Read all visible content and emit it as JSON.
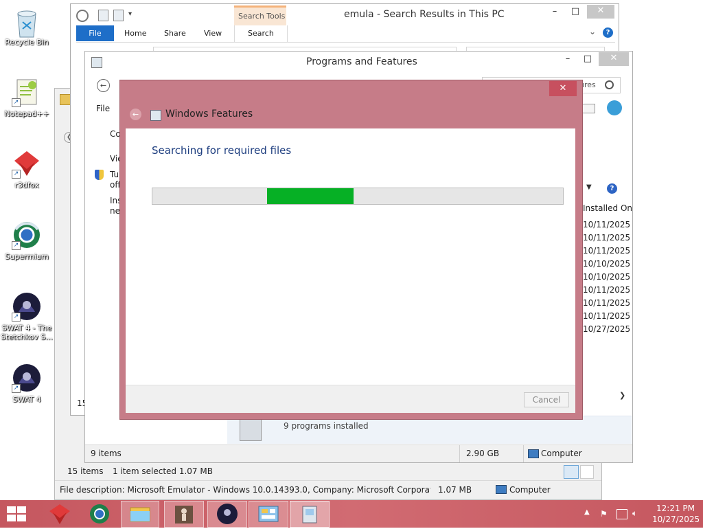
{
  "desktop_icons": [
    {
      "label": "Recycle Bin",
      "icon": "recycle-bin-icon"
    },
    {
      "label": "Notepad++",
      "icon": "notepad-plus-plus-icon"
    },
    {
      "label": "r3dfox",
      "icon": "r3dfox-icon"
    },
    {
      "label": "Supermium",
      "icon": "supermium-icon"
    },
    {
      "label": "SWAT 4 - The Stetchkov S...",
      "icon": "swat4-expansion-icon"
    },
    {
      "label": "SWAT 4",
      "icon": "swat4-icon"
    }
  ],
  "explorer": {
    "title": "emula - Search Results in This PC",
    "contextual_tab": "Search Tools",
    "ribbon_tabs": [
      "File",
      "Home",
      "Share",
      "View",
      "Search"
    ],
    "status_items": "15 items",
    "status_selected": "1 item selected  1.07 MB",
    "details_bar": "File description: Microsoft Emulator - Windows 10.0.14393.0, Company: Microsoft Corporation, File vers",
    "details_size": "1.07 MB",
    "details_location": "Computer",
    "side_partial": "15"
  },
  "programs": {
    "title": "Programs and Features",
    "menu_file": "File",
    "search_partial": "ures",
    "left_links": [
      "Co",
      "Vie",
      "Tur",
      "off",
      "Inst",
      "net"
    ],
    "column_installed_on": "Installed On",
    "installed_dates": [
      "10/11/2025",
      "10/11/2025",
      "10/11/2025",
      "10/10/2025",
      "10/10/2025",
      "10/11/2025",
      "10/11/2025",
      "10/11/2025",
      "10/27/2025"
    ],
    "programs_installed": "9 programs installed",
    "status_items": "9 items",
    "status_size": "2.90 GB",
    "status_location": "Computer"
  },
  "features_dialog": {
    "title": "Windows Features",
    "heading": "Searching for required files",
    "progress_segment_start": 0.28,
    "progress_segment_width": 0.21,
    "cancel_label": "Cancel"
  },
  "taskbar": {
    "time": "12:21 PM",
    "date": "10/27/2025",
    "apps": [
      "r3dfox",
      "Supermium",
      "File Explorer",
      "Unknown program",
      "SWAT 4",
      "Control Panel",
      "Windows Features"
    ]
  },
  "colors": {
    "dialog_frame": "#c67c88",
    "accent_blue": "#1e6ec8",
    "progress_green": "#06b025",
    "taskbar": "#c5575f"
  }
}
